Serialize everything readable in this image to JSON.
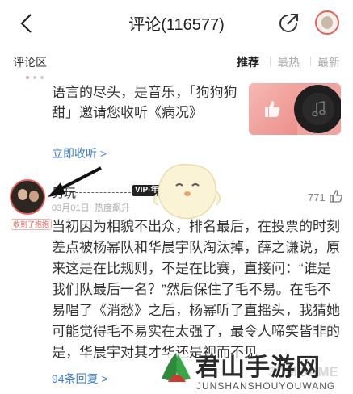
{
  "header": {
    "title": "评论(116577)",
    "back_icon": "chevron-left-icon",
    "share_icon": "share-arrow-icon",
    "avatar": "user-avatar"
  },
  "section": {
    "title": "评论区",
    "sort": [
      "推荐",
      "最热",
      "最新"
    ],
    "active_sort": "推荐"
  },
  "share_block": {
    "text": "语言的尽头，是音乐，「狗狗狗甜」邀请您收听《病况》",
    "link": "立即收听 >",
    "card_icon": "music-note-icon"
  },
  "comment": {
    "username_partial": "另玩",
    "vip_label": "VIP·年",
    "avatar_badge": "收到了抱抱",
    "date": "03月01日",
    "tag": "热度飙升",
    "likes": "771",
    "text": "当初因为相貌不出众，排名最后，在投票的时刻差点被杨幂队和华晨宇队淘汰掉，薛之谦说，原来这是在比规则，不是在比赛，直接问：“谁是我们队最后一名？”然后保住了毛不易。在毛不易唱了《消愁》之后，杨幂听了直摇头，我猜她可能觉得毛不易实在太强了，最令人啼笑皆非的是，华晨宇对其才华还是视而不见",
    "replies": "94条回复 >"
  },
  "watermark": {
    "title": "君山手游网",
    "subtitle": "JUNSHANSHOUYOUWANG",
    "overlay": "3DMGAME"
  },
  "colors": {
    "accent": "#e3625e",
    "link": "#3d7fc8"
  }
}
